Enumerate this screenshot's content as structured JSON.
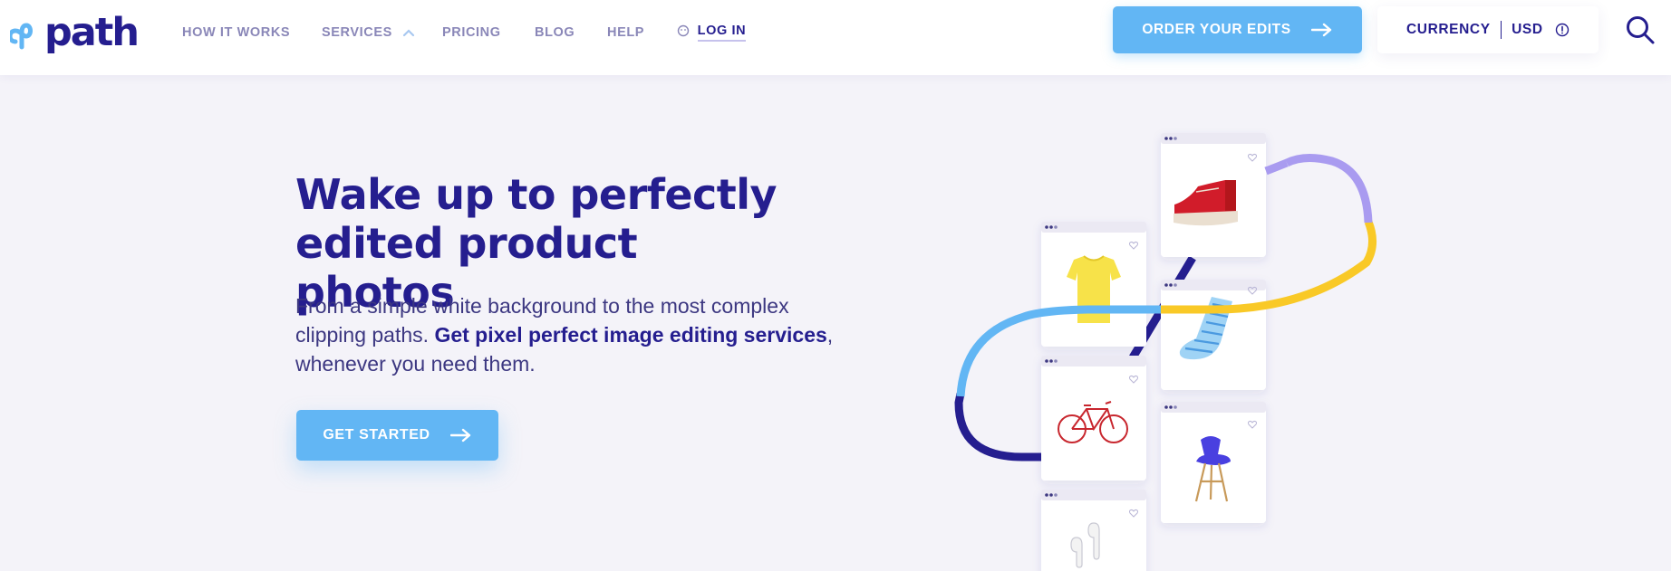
{
  "header": {
    "logo_text": "path",
    "nav": {
      "how_it_works": "HOW IT WORKS",
      "services": "SERVICES",
      "pricing": "PRICING",
      "blog": "BLOG",
      "help": "HELP",
      "login": "LOG IN"
    },
    "order_button": "ORDER YOUR EDITS",
    "currency": {
      "label": "CURRENCY",
      "value": "USD"
    }
  },
  "hero": {
    "title_line1": "Wake up to perfectly",
    "title_line2": "edited product photos",
    "desc_part1": "From a simple white background to the most complex clipping paths. ",
    "desc_bold": "Get pixel perfect image editing services",
    "desc_part2": ", whenever you need them.",
    "cta": "GET STARTED"
  },
  "illustration": {
    "products": [
      "red-sneaker",
      "yellow-tshirt",
      "striped-sock",
      "red-bicycle",
      "blue-chair",
      "white-earbuds"
    ]
  },
  "colors": {
    "brand": "#251e8f",
    "accent": "#62b6f4",
    "nav_text": "#8a87b8",
    "background": "#f4f3f9",
    "path_purple": "#a99bf0",
    "path_yellow": "#f9c927"
  },
  "icons": [
    "infinity-logo-icon",
    "chevron-up-icon",
    "user-icon",
    "arrow-right-icon",
    "info-icon",
    "search-icon",
    "heart-icon"
  ]
}
